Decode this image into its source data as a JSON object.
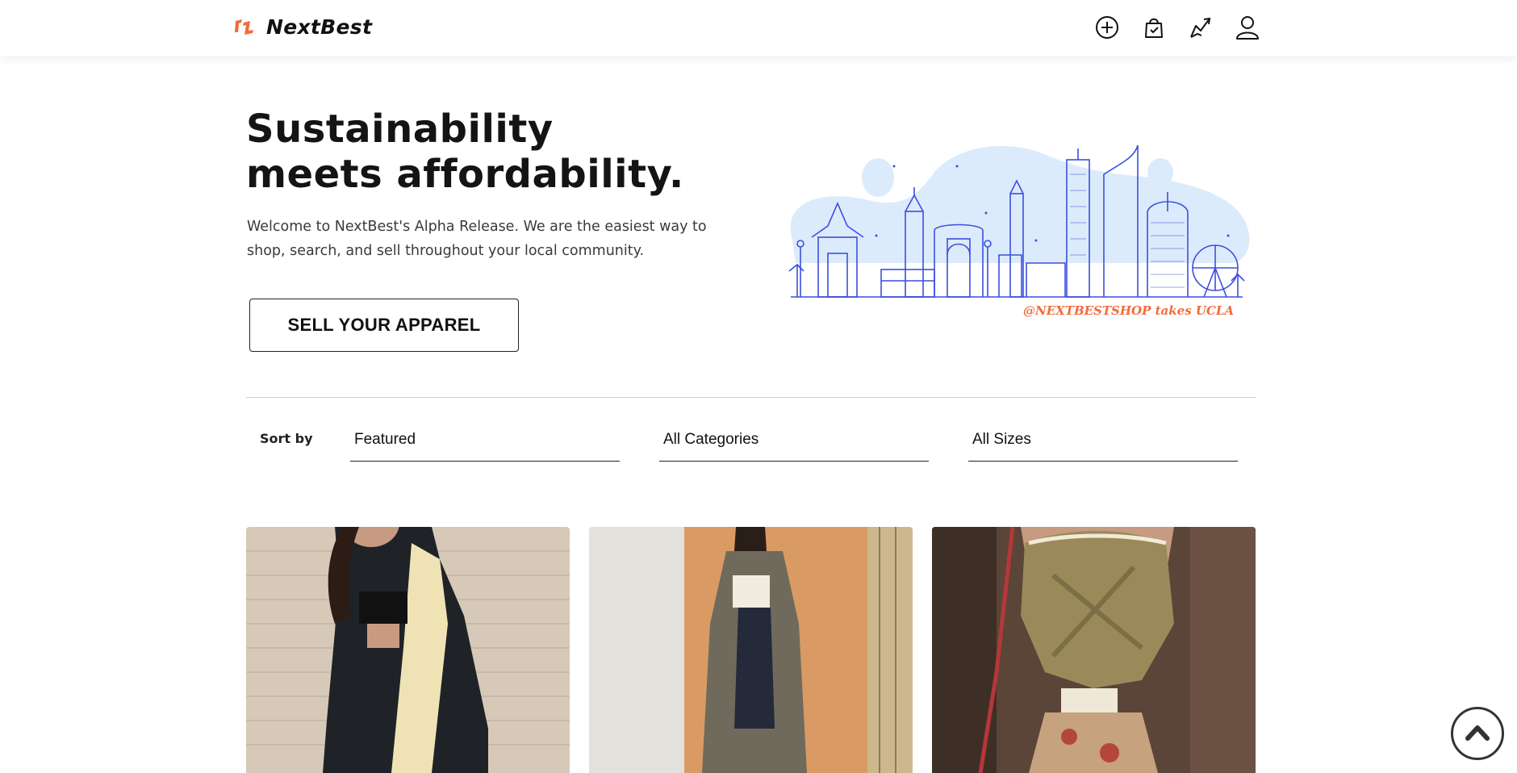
{
  "header": {
    "brand_name": "NextBest",
    "logo_icon": "nextbest-logo-icon",
    "nav_icons": [
      "add-circle-icon",
      "shopping-bag-icon",
      "trending-icon",
      "user-icon"
    ]
  },
  "hero": {
    "title_line1": "Sustainability",
    "title_line2": "meets affordability.",
    "subtitle": "Welcome to NextBest's Alpha Release. We are the easiest way to shop, search, and sell throughout your local community.",
    "cta_label": "SELL YOUR APPAREL",
    "illustration_caption": "@NEXTBESTSHOP takes UCLA"
  },
  "filters": {
    "sort_label": "Sort by",
    "sort_value": "Featured",
    "category_value": "All Categories",
    "size_value": "All Sizes"
  },
  "products": [
    {
      "image": "woman-leather-coat-fur-collar"
    },
    {
      "image": "woman-long-olive-trench-coat"
    },
    {
      "image": "model-draped-olive-corset-top"
    }
  ],
  "colors": {
    "accent": "#f26b3a",
    "skyline_line": "#3b4fe0",
    "skyline_fill": "#dcebfb"
  },
  "scroll_top_icon": "chevron-up-circle-icon"
}
